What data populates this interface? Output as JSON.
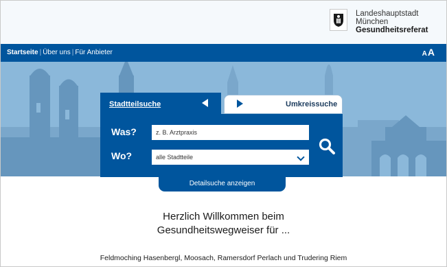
{
  "header": {
    "brand_line1": "Landeshauptstadt",
    "brand_line2": "München",
    "brand_line3": "Gesundheitsreferat"
  },
  "nav": {
    "items": [
      "Startseite",
      "Über uns",
      "Für Anbieter"
    ],
    "fontsize_small": "A",
    "fontsize_large": "A"
  },
  "search": {
    "tab_active": "Stadtteilsuche",
    "tab_inactive": "Umkreissuche",
    "was_label": "Was?",
    "was_placeholder": "z. B. Arztpraxis",
    "wo_label": "Wo?",
    "wo_value": "alle Stadtteile",
    "detail_button": "Detailsuche anzeigen"
  },
  "welcome": {
    "line1": "Herzlich Willkommen beim",
    "line2": "Gesundheitswegweiser für ...",
    "districts": "Feldmoching Hasenbergl, Moosach, Ramersdorf Perlach und Trudering Riem"
  },
  "colors": {
    "primary": "#00559d",
    "hero": "#8bb8da",
    "header_bg": "#f5f9fc"
  }
}
